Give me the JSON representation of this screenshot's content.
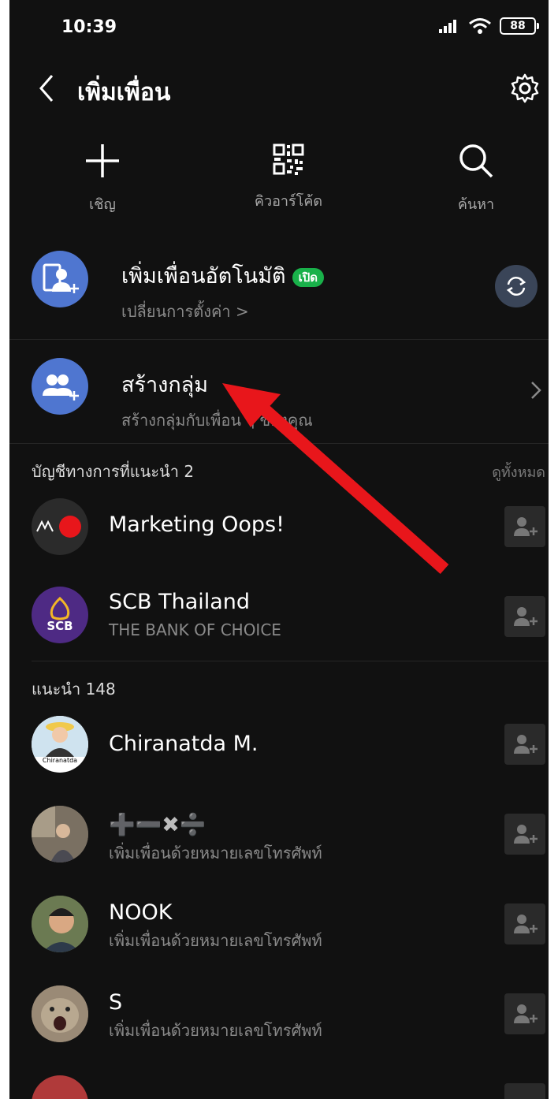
{
  "status": {
    "time": "10:39",
    "battery": "88"
  },
  "header": {
    "title": "เพิ่มเพื่อน"
  },
  "actions": [
    {
      "label": "เชิญ",
      "icon": "plus-icon"
    },
    {
      "label": "คิวอาร์โค้ด",
      "icon": "qr-code-icon"
    },
    {
      "label": "ค้นหา",
      "icon": "search-icon"
    }
  ],
  "auto_add": {
    "title": "เพิ่มเพื่อนอัตโนมัติ",
    "badge": "เปิด",
    "subtitle": "เปลี่ยนการตั้งค่า >"
  },
  "create_group": {
    "title": "สร้างกลุ่ม",
    "subtitle": "สร้างกลุ่มกับเพื่อน ๆ ของคุณ"
  },
  "official": {
    "label": "บัญชีทางการที่แนะนำ 2",
    "see_all": "ดูทั้งหมด",
    "items": [
      {
        "name": "Marketing Oops!",
        "subtitle": ""
      },
      {
        "name": "SCB Thailand",
        "subtitle": "THE BANK OF CHOICE",
        "avatar_text": "SCB"
      }
    ]
  },
  "suggested": {
    "label": "แนะนำ 148",
    "items": [
      {
        "name": "Chiranatda M.",
        "subtitle": "",
        "avatar_caption": "Chiranatda"
      },
      {
        "name": "➕➖✖➗",
        "subtitle": "เพิ่มเพื่อนด้วยหมายเลขโทรศัพท์"
      },
      {
        "name": "NOOK",
        "subtitle": "เพิ่มเพื่อนด้วยหมายเลขโทรศัพท์"
      },
      {
        "name": "S",
        "subtitle": "เพิ่มเพื่อนด้วยหมายเลขโทรศัพท์"
      }
    ]
  },
  "colors": {
    "background": "#111111",
    "accent_blue": "#4f76d0",
    "badge_green": "#19b14a",
    "arrow_red": "#e8161b"
  }
}
